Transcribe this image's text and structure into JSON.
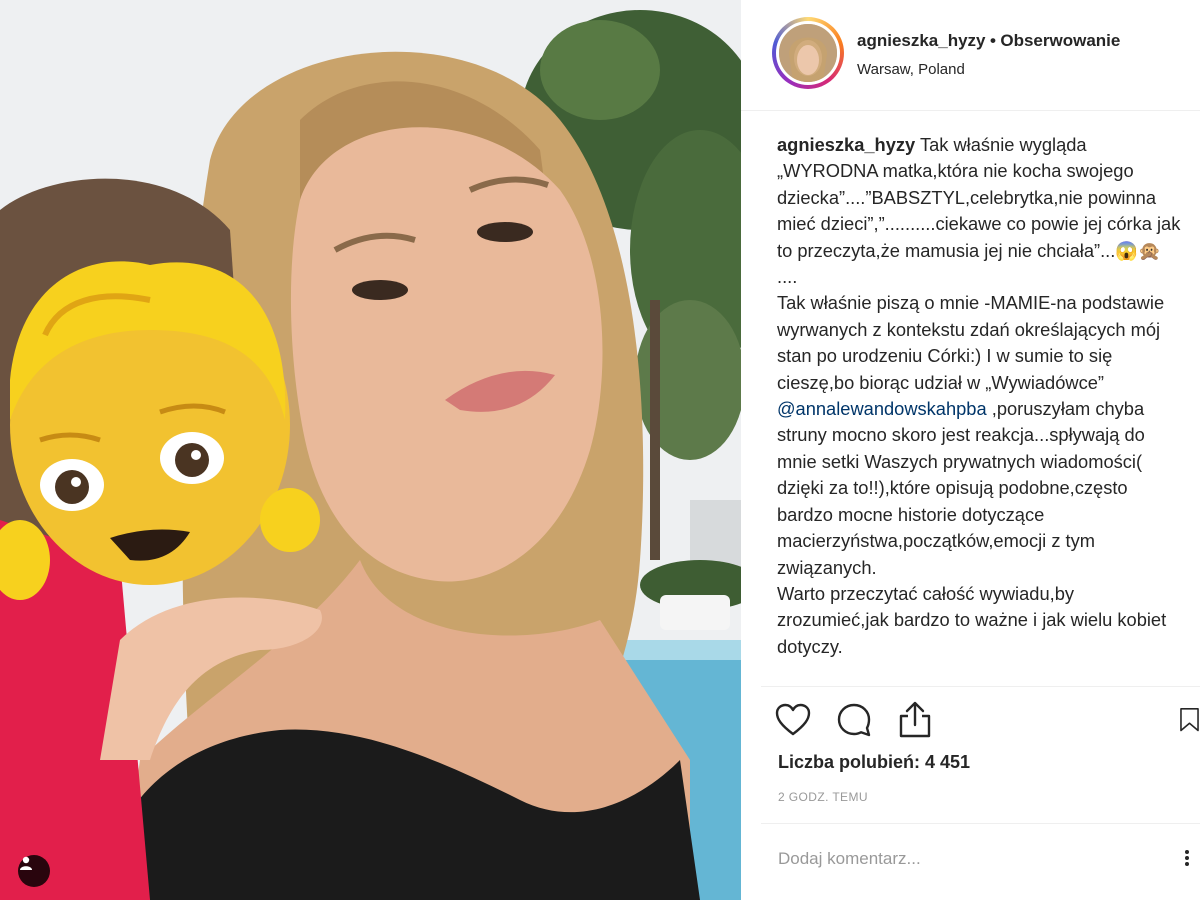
{
  "post": {
    "username": "agnieszka_hyzy",
    "separator": "•",
    "follow_label": "Obserwowanie",
    "location": "Warsaw, Poland"
  },
  "caption": {
    "user": "agnieszka_hyzy",
    "text_part1": " Tak właśnie wygląda „WYRODNA matka,która nie kocha swojego dziecka”....”BABSZTYL,celebrytka,nie powinna mieć dzieci”,”..........ciekawe co powie jej córka jak to przeczyta,że mamusia jej nie chciała”...😱🙊\n....\nTak właśnie piszą o mnie -MAMIE-na podstawie wyrwanych z kontekstu zdań określających mój stan po urodzeniu Córki:) I w sumie to się cieszę,bo biorąc udział w „Wywiadówce” ",
    "mention": "@annalewandowskahpba",
    "text_part2": " ,poruszyłam chyba struny mocno skoro jest reakcja...spływają do mnie setki Waszych prywatnych wiadomości( dzięki za to!!),które opisują podobne,często bardzo mocne historie dotyczące macierzyństwa,początków,emocji z tym związanych.\nWarto przeczytać całość wywiadu,by zrozumieć,jak bardzo to ważne i jak wielu kobiet dotyczy."
  },
  "actions": {
    "like_icon": "heart-icon",
    "comment_icon": "comment-icon",
    "share_icon": "share-icon",
    "save_icon": "bookmark-icon"
  },
  "likes_label": "Liczba polubień: 4 451",
  "time_label": "2 GODZ. TEMU",
  "comment": {
    "placeholder": "Dodaj komentarz..."
  },
  "colors": {
    "text": "#262626",
    "muted": "#999999",
    "mention": "#003569",
    "border": "#efefef"
  }
}
